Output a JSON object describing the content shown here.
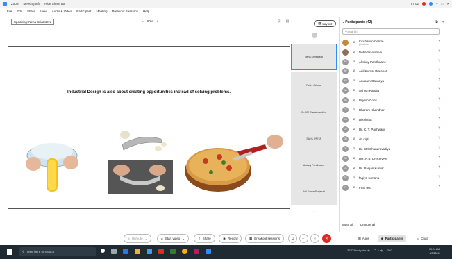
{
  "titlebar": {
    "app_name": "Zoom",
    "tabs": [
      "Meeting Info",
      "Hide Share Ba"
    ],
    "time": "57:02"
  },
  "menu": [
    "File",
    "Edit",
    "Share",
    "View",
    "Audio & Video",
    "Participant",
    "Meeting",
    "Breakout Sessions",
    "Help"
  ],
  "toolbar": {
    "speaking": "Speaking: Neha Srivastava",
    "zoom_level": "80%",
    "layout_label": "Layout"
  },
  "slide": {
    "heading": "Industrial Design is also about creating opportunities instead of solving problems."
  },
  "video_tiles": [
    "Neha Srivastava",
    "Ruchi Jaiswal",
    "Dr. KM Chandravadiya",
    "SAHIL PRIYA",
    "Akshay Pandhaane",
    "Anil Kumar Prajapati"
  ],
  "panel": {
    "title": "Participants (42)",
    "search_placeholder": "Search",
    "participants": [
      {
        "initials": "",
        "name": "Incubation Centre",
        "sub": "(Host, me)",
        "mic": "muted"
      },
      {
        "initials": "",
        "name": "Neha Srivastava",
        "sub": "",
        "mic": "on"
      },
      {
        "initials": "AP",
        "name": "Akshay Pandhaane",
        "sub": "",
        "mic": "muted"
      },
      {
        "initials": "AP",
        "name": "Anil Kumar Prajapati",
        "sub": "",
        "mic": "muted"
      },
      {
        "initials": "AG",
        "name": "Anupam Gavariya",
        "sub": "",
        "mic": "muted"
      },
      {
        "initials": "AR",
        "name": "Ashish Ranala",
        "sub": "",
        "mic": "muted"
      },
      {
        "initials": "BG",
        "name": "Brijesh Gohil",
        "sub": "",
        "mic": "muted"
      },
      {
        "initials": "DK",
        "name": "Dharam Khandhar",
        "sub": "",
        "mic": "muted"
      },
      {
        "initials": "DS",
        "name": "Dikshitha",
        "sub": "",
        "mic": "muted"
      },
      {
        "initials": "DP",
        "name": "Dr. C. T. Pachwani",
        "sub": "",
        "mic": "muted"
      },
      {
        "initials": "DD",
        "name": "dr. dipti",
        "sub": "",
        "mic": "muted"
      },
      {
        "initials": "DC",
        "name": "Dr. KM Chandravadiya",
        "sub": "",
        "mic": "muted"
      },
      {
        "initials": "DR",
        "name": "DR. N.B. DHRUVAN",
        "sub": "",
        "mic": "muted"
      },
      {
        "initials": "DK",
        "name": "Dr. Ranjan Kumar",
        "sub": "",
        "mic": "muted"
      },
      {
        "initials": "FS",
        "name": "fagiya sumana",
        "sub": "",
        "mic": "muted"
      },
      {
        "initials": "F",
        "name": "Fusi Test",
        "sub": "",
        "mic": "muted"
      }
    ],
    "mute_all": "Mute all",
    "unmute_all": "Unmute all"
  },
  "controls": {
    "unmute": "Unmute",
    "start_video": "Start video",
    "share": "Share",
    "record": "Record",
    "breakout": "Breakout sessions",
    "apps": "Apps",
    "participants": "Participants",
    "chat": "Chat"
  },
  "taskbar": {
    "search_placeholder": "Type here to search",
    "weather": "30°C Mostly cloudy",
    "lang": "ENG",
    "time": "10:24 AM",
    "date": "4/3/2024"
  },
  "colors": {
    "accent": "#2d8cff",
    "mute_red": "#e02828",
    "mic_green": "#24a148",
    "taskbar": "#1f2a33"
  }
}
